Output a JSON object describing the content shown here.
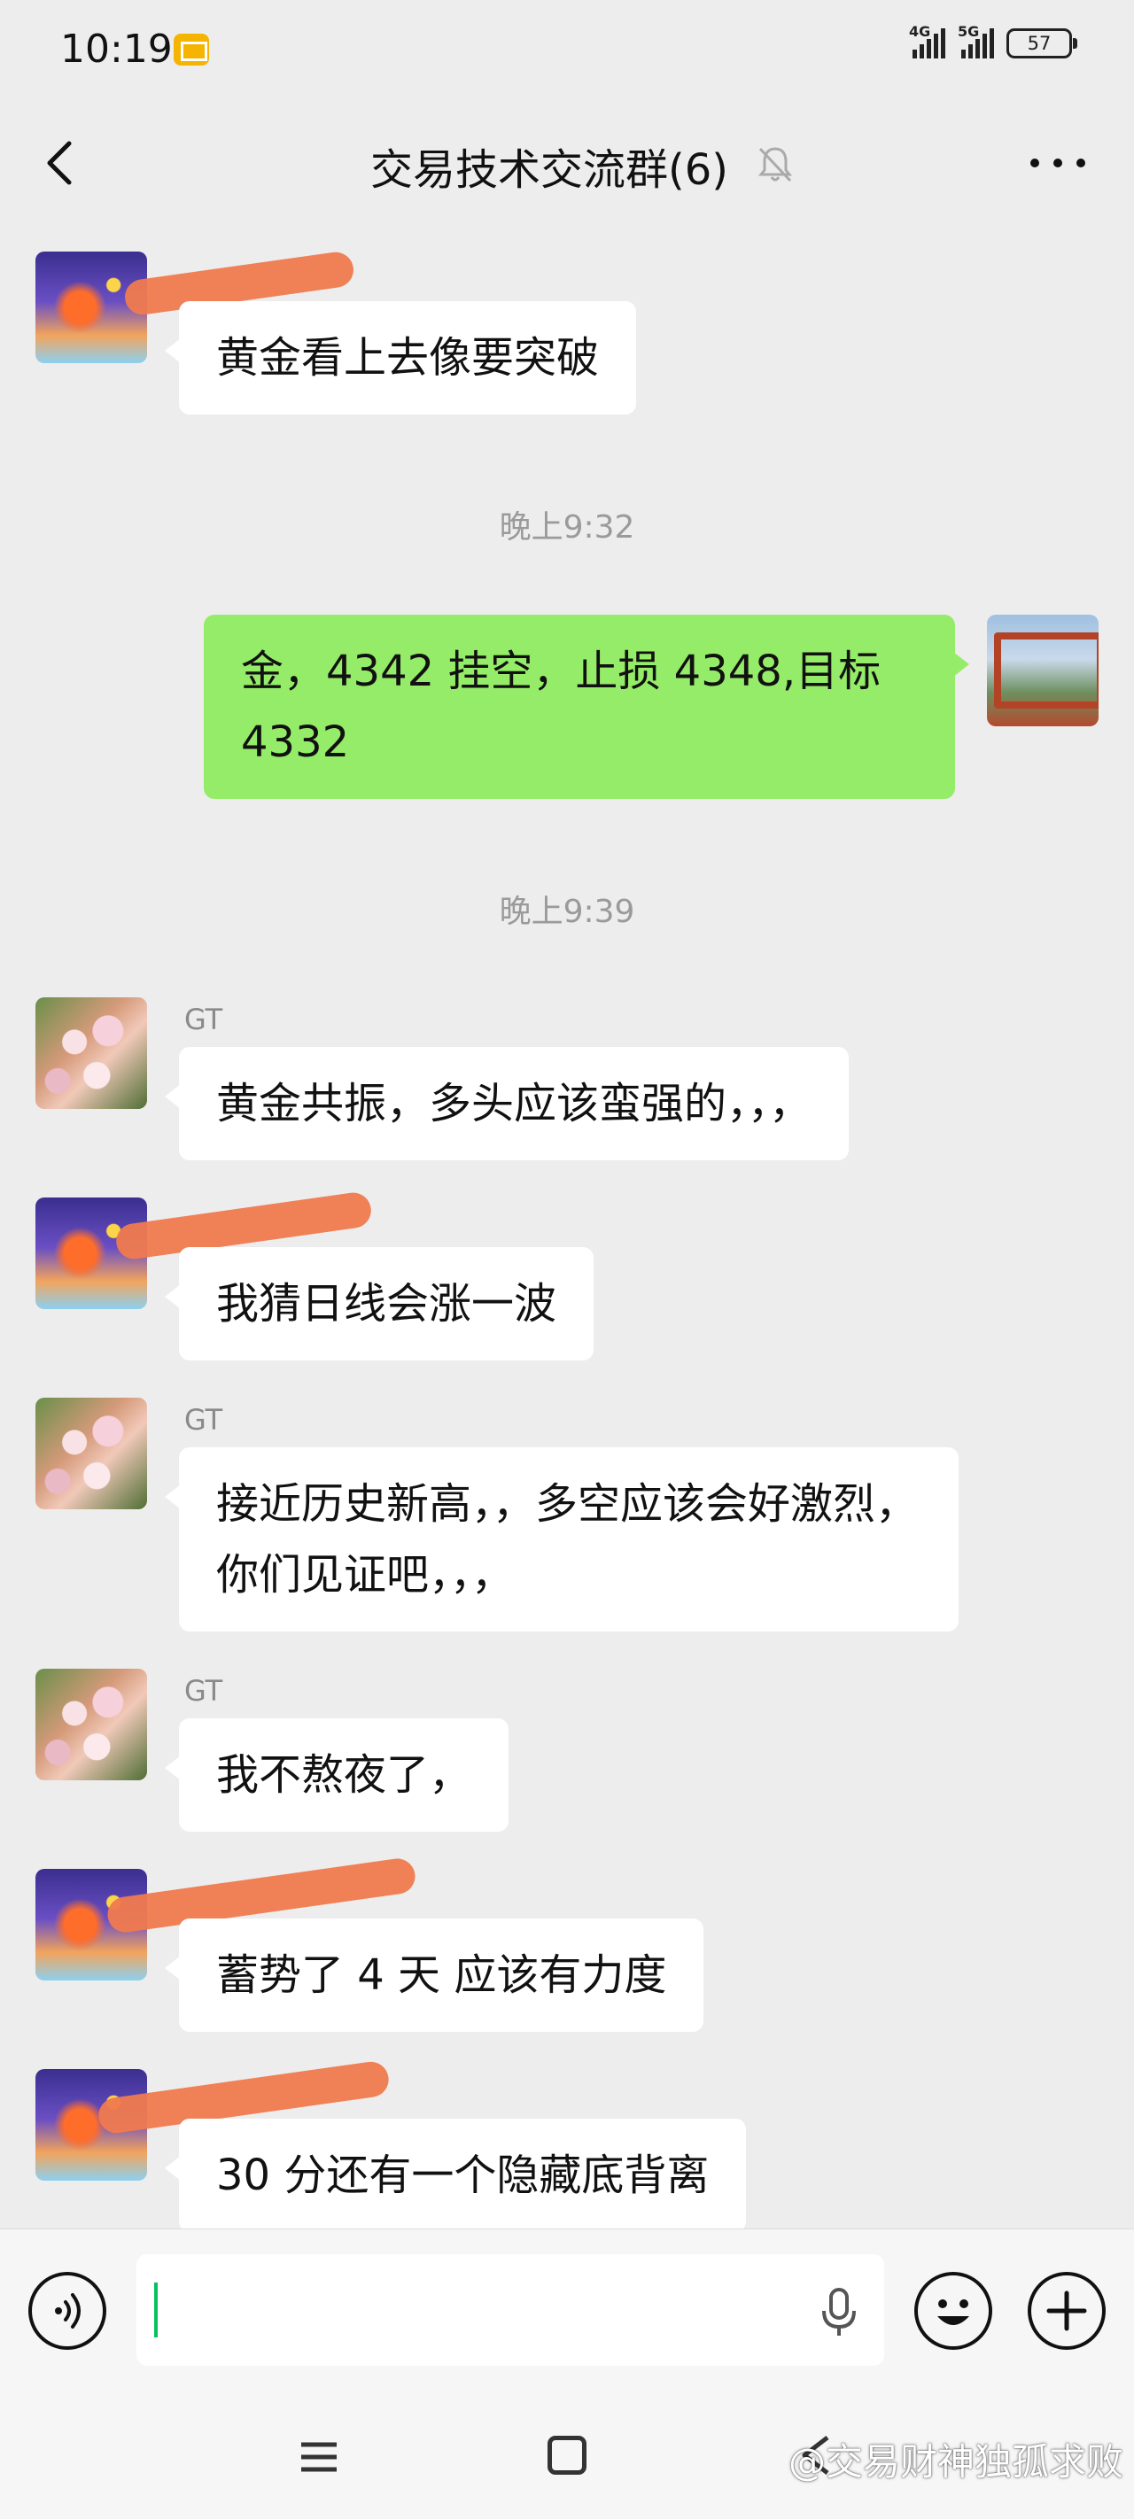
{
  "status_bar": {
    "time": "10:19",
    "net1": "4G",
    "net2": "5G",
    "battery": "57"
  },
  "header": {
    "title": "交易技术交流群(6)"
  },
  "messages": [
    {
      "sender": "",
      "text": "黄金看上去像要突破"
    },
    {
      "time": "晚上9:32"
    },
    {
      "sender": "me",
      "text": "金，4342 挂空，止损 4348,目标 4332"
    },
    {
      "time": "晚上9:39"
    },
    {
      "sender": "GT",
      "text": "黄金共振，多头应该蛮强的，，，"
    },
    {
      "sender": "",
      "text": "我猜日线会涨一波"
    },
    {
      "sender": "GT",
      "text": "接近历史新高，，多空应该会好激烈，你们见证吧，，，"
    },
    {
      "sender": "GT",
      "text": "我不熬夜了，"
    },
    {
      "sender": "",
      "text": "蓄势了 4 天 应该有力度"
    },
    {
      "sender": "",
      "text": "30 分还有一个隐藏底背离"
    }
  ],
  "watermark": "@交易财神独孤求败",
  "colors": {
    "mine_bubble": "#95ec69",
    "other_bubble": "#ffffff",
    "background": "#ededed",
    "scribble": "#f07a4e"
  }
}
